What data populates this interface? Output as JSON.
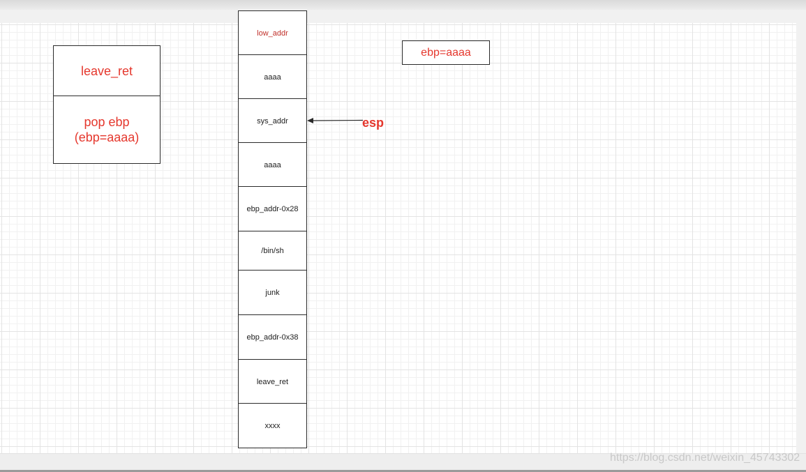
{
  "diagram": {
    "leave_box": {
      "label": "leave_ret"
    },
    "pop_box": {
      "line1": "pop ebp",
      "line2": "(ebp=aaaa)"
    },
    "register_box": {
      "label": "ebp=aaaa"
    },
    "esp_pointer": {
      "label": "esp",
      "points_to_cell_index": 2
    },
    "stack": [
      {
        "label": "low_addr",
        "color": "#c0302a"
      },
      {
        "label": "aaaa"
      },
      {
        "label": "sys_addr"
      },
      {
        "label": "aaaa"
      },
      {
        "label": "ebp_addr-0x28"
      },
      {
        "label": "/bin/sh"
      },
      {
        "label": "junk"
      },
      {
        "label": "ebp_addr-0x38"
      },
      {
        "label": "leave_ret"
      },
      {
        "label": "xxxx"
      }
    ]
  },
  "watermark": "https://blog.csdn.net/weixin_45743302",
  "colors": {
    "annotation_red": "#e5372d",
    "box_border": "#2a2a2a"
  }
}
